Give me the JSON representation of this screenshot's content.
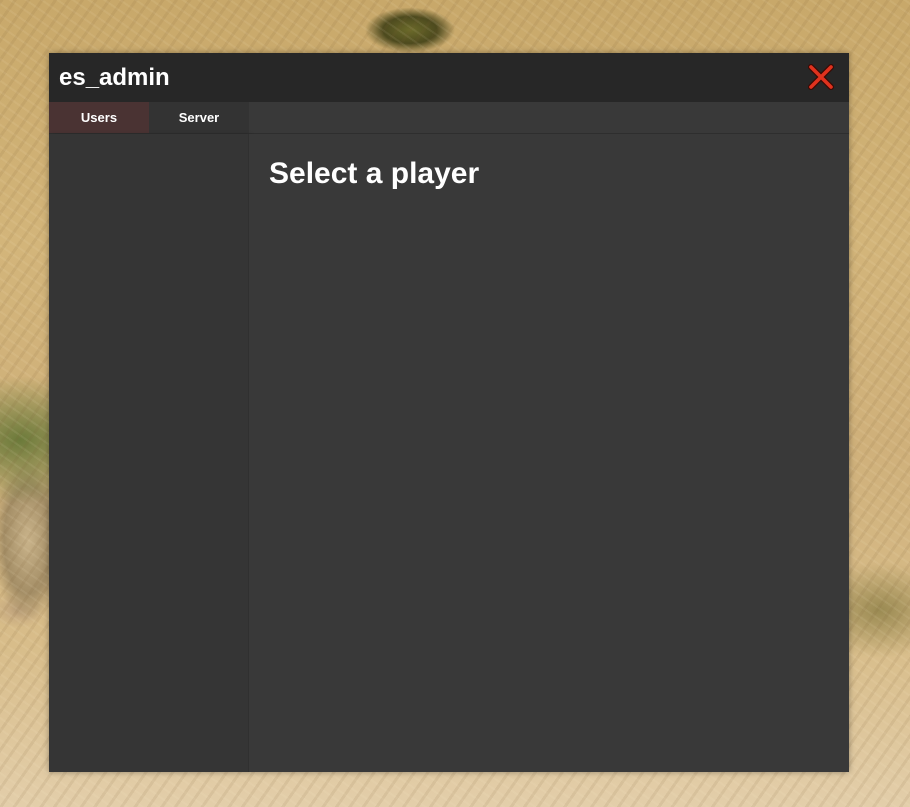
{
  "window": {
    "title": "es_admin",
    "close_icon": "close-x-icon",
    "close_color": "#e0321e"
  },
  "tabs": [
    {
      "label": "Users",
      "active": true
    },
    {
      "label": "Server",
      "active": false
    }
  ],
  "sidebar": {
    "players": []
  },
  "main": {
    "heading": "Select a player"
  },
  "colors": {
    "titlebar": "#272727",
    "panel": "#393939",
    "sidebar": "#353535",
    "active_tab": "#4a3333",
    "inactive_tab": "#333333",
    "text": "#ffffff"
  }
}
